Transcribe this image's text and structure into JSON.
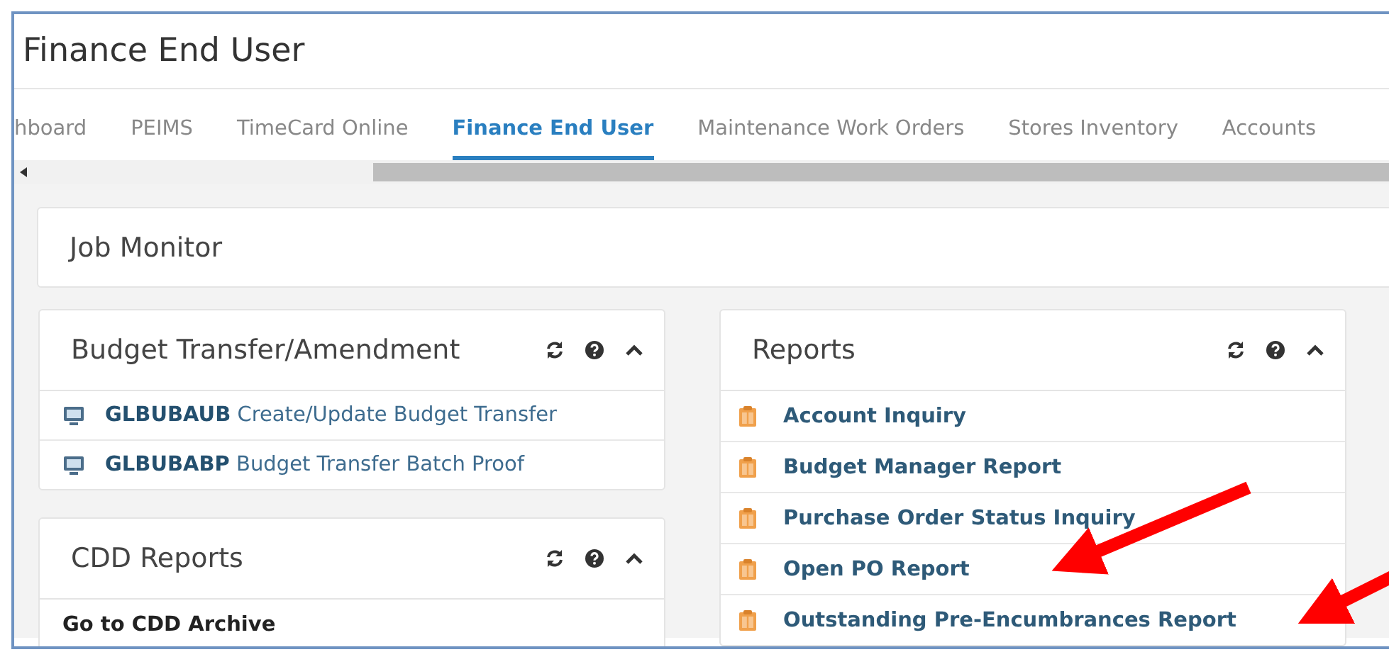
{
  "window": {
    "title": "Finance End User"
  },
  "tabs": [
    {
      "label": "hboard",
      "selected": false
    },
    {
      "label": "PEIMS",
      "selected": false
    },
    {
      "label": "TimeCard Online",
      "selected": false
    },
    {
      "label": "Finance End User",
      "selected": true
    },
    {
      "label": "Maintenance Work Orders",
      "selected": false
    },
    {
      "label": "Stores Inventory",
      "selected": false
    },
    {
      "label": "Accounts",
      "selected": false
    }
  ],
  "job_monitor": {
    "title": "Job Monitor"
  },
  "left_panels": [
    {
      "title": "Budget Transfer/Amendment",
      "items": [
        {
          "kind": "program",
          "label": "**GLBUBAUB** Create/Update Budget Transfer"
        },
        {
          "kind": "program",
          "label": "**GLBUBABP** Budget Transfer Batch Proof"
        }
      ]
    },
    {
      "title": "CDD Reports",
      "items": [
        {
          "kind": "link",
          "label": "Go to CDD Archive"
        }
      ]
    }
  ],
  "right_panels": [
    {
      "title": "Reports",
      "items": [
        {
          "kind": "report",
          "label": "Account Inquiry"
        },
        {
          "kind": "report",
          "label": "Budget Manager Report"
        },
        {
          "kind": "report",
          "label": "Purchase Order Status Inquiry"
        },
        {
          "kind": "report",
          "label": "Open PO Report"
        },
        {
          "kind": "report",
          "label": "Outstanding Pre-Encumbrances Report"
        }
      ]
    }
  ]
}
